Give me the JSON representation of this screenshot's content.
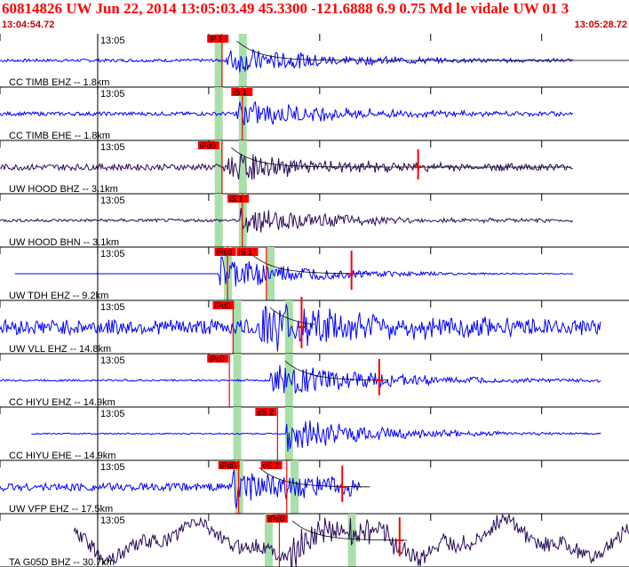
{
  "header": {
    "title": "60814826 UW Jun 22, 2014 13:05:03.49   45.3300 -121.6888  6.9 0.75 Md le vidale UW 01   3",
    "start_time": "13:04:54.72",
    "end_time": "13:05:28.72"
  },
  "colors": {
    "title": "#ff0000",
    "trace": "#0000ff",
    "trace_dark": "#2a0a5a",
    "pick": "#ff0000",
    "window": "#a9e0a9",
    "grid": "#000000"
  },
  "chart_data": {
    "type": "seismogram-record",
    "x_range": [
      "13:04:54.72",
      "13:05:28.72"
    ],
    "x_unit": "seconds since 13:04:54.72",
    "x_max_seconds": 34.0,
    "tick_label": "13:05",
    "tick_seconds": 5.28,
    "grid_seconds": [
      0.0,
      5.28,
      11.28,
      17.28,
      23.28,
      29.28
    ],
    "traces": [
      {
        "label": "CC TIMB EHZ -- 1.8km",
        "color_key": "trace",
        "amp": 14,
        "start": 0.0,
        "end": 31.0,
        "noise": 0.12,
        "onset": 12.2,
        "coda": 6,
        "picks": [
          {
            "label": "iP 1",
            "t": 11.2,
            "line": 12.0
          }
        ],
        "windows": [
          11.8,
          13.1
        ],
        "decay": {
          "from": 12.8,
          "to": 34.0
        },
        "markers": []
      },
      {
        "label": "CC TIMB EHE -- 1.8km",
        "color_key": "trace",
        "amp": 14,
        "start": 0.0,
        "end": 31.0,
        "noise": 0.15,
        "onset": 12.7,
        "coda": 6,
        "picks": [
          {
            "label": "iS 1",
            "t": 12.5,
            "line": 13.1
          }
        ],
        "windows": [
          11.8,
          13.1
        ],
        "decay": null,
        "markers": []
      },
      {
        "label": "UW HOOD BHZ -- 3.1km",
        "color_key": "trace_dark",
        "amp": 14,
        "start": 0.0,
        "end": 31.0,
        "noise": 0.25,
        "onset": 12.1,
        "coda": 6,
        "picks": [
          {
            "label": "iPd0",
            "t": 10.7,
            "line": 12.0
          }
        ],
        "windows": [
          11.8,
          13.1
        ],
        "decay": {
          "from": 12.5,
          "to": 31.0
        },
        "markers": [
          {
            "t": 22.6,
            "h": 20
          }
        ]
      },
      {
        "label": "UW HOOD BHN -- 3.1km",
        "color_key": "trace_dark",
        "amp": 14,
        "start": 0.0,
        "end": 31.0,
        "noise": 0.12,
        "onset": 13.0,
        "coda": 5,
        "picks": [
          {
            "label": "iS 1",
            "t": 12.3,
            "line": 13.1
          }
        ],
        "windows": [
          11.8,
          13.1
        ],
        "decay": null,
        "markers": []
      },
      {
        "label": "UW TDH EHZ -- 9.2km",
        "color_key": "trace",
        "amp": 18,
        "start": 0.8,
        "end": 31.0,
        "noise": 0.0,
        "onset": 11.8,
        "coda": 5,
        "picks": [
          {
            "label": "iPd0",
            "t": 11.6,
            "line": 12.3
          },
          {
            "label": "iS 1",
            "t": 12.8,
            "line": 14.4
          }
        ],
        "windows": [
          12.3,
          14.6
        ],
        "decay": {
          "from": 13.6,
          "to": 20.0
        },
        "markers": [
          {
            "t": 19.0,
            "h": 26
          }
        ]
      },
      {
        "label": "UW VLL EHZ -- 14.8km",
        "color_key": "trace",
        "amp": 24,
        "start": 0.0,
        "end": 32.5,
        "noise": 0.35,
        "onset": 14.0,
        "coda": 7,
        "picks": [
          {
            "label": "iPd0",
            "t": 11.5,
            "line": 12.6
          }
        ],
        "windows": [
          12.8,
          15.6
        ],
        "decay": {
          "from": 14.6,
          "to": 17.0
        },
        "markers": [
          {
            "t": 16.3,
            "h": 34
          }
        ]
      },
      {
        "label": "CC HIYU EHZ -- 14.9km",
        "color_key": "trace",
        "amp": 18,
        "start": 0.0,
        "end": 32.5,
        "noise": 0.06,
        "onset": 14.6,
        "coda": 6,
        "picks": [
          {
            "label": "iPc0",
            "t": 11.2,
            "line": 12.4
          }
        ],
        "windows": [
          12.8,
          15.6
        ],
        "decay": {
          "from": 15.4,
          "to": 21.0
        },
        "markers": [
          {
            "t": 20.5,
            "h": 24
          }
        ]
      },
      {
        "label": "CC HIYU EHE -- 14.9km",
        "color_key": "trace",
        "amp": 18,
        "start": 1.7,
        "end": 32.5,
        "noise": 0.04,
        "onset": 15.5,
        "coda": 5,
        "picks": [
          {
            "label": "eS 2",
            "t": 13.8,
            "line": 15.0
          }
        ],
        "windows": [
          12.8,
          15.6
        ],
        "decay": null,
        "markers": []
      },
      {
        "label": "UW VFP EHZ -- 17.5km",
        "color_key": "trace",
        "amp": 20,
        "start": 0.0,
        "end": 19.5,
        "noise": 0.22,
        "onset": 12.4,
        "coda": 6,
        "picks": [
          {
            "label": "iPd0",
            "t": 11.8,
            "line": 12.9
          },
          {
            "label": "eS 2",
            "t": 14.1,
            "line": 15.5
          }
        ],
        "windows": [
          12.9,
          15.9
        ],
        "decay": {
          "from": 14.0,
          "to": 20.0
        },
        "markers": [
          {
            "t": 18.5,
            "h": 24
          }
        ]
      },
      {
        "label": "TA G05D BHZ -- 30.7km",
        "color_key": "trace_dark",
        "amp": 16,
        "start": 4.0,
        "end": 34.0,
        "noise": 0.5,
        "onset": 15.5,
        "coda": 7,
        "swell": true,
        "picks": [
          {
            "label": "iPd0",
            "t": 14.4,
            "line": 15.1
          }
        ],
        "windows": [
          14.5,
          19.0
        ],
        "decay": {
          "from": 15.8,
          "to": 22.0
        },
        "markers": [
          {
            "t": 21.6,
            "h": 26
          }
        ]
      }
    ]
  }
}
